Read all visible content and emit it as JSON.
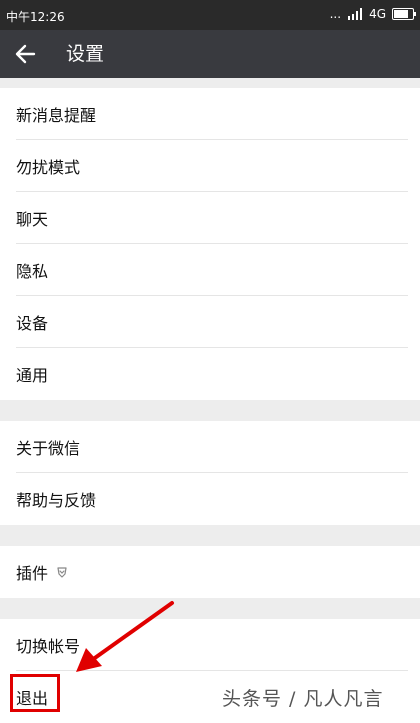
{
  "status_bar": {
    "time": "中午12:26",
    "dots": "...",
    "network": "4G"
  },
  "header": {
    "title": "设置"
  },
  "groups": [
    {
      "items": [
        {
          "label": "新消息提醒"
        },
        {
          "label": "勿扰模式"
        },
        {
          "label": "聊天"
        },
        {
          "label": "隐私"
        },
        {
          "label": "设备"
        },
        {
          "label": "通用"
        }
      ]
    },
    {
      "items": [
        {
          "label": "关于微信"
        },
        {
          "label": "帮助与反馈"
        }
      ]
    },
    {
      "items": [
        {
          "label": "插件"
        }
      ]
    },
    {
      "items": [
        {
          "label": "切换帐号"
        },
        {
          "label": "退出"
        }
      ]
    }
  ],
  "annotation_color": "#e00000",
  "watermark": "头条号 / 凡人凡言"
}
